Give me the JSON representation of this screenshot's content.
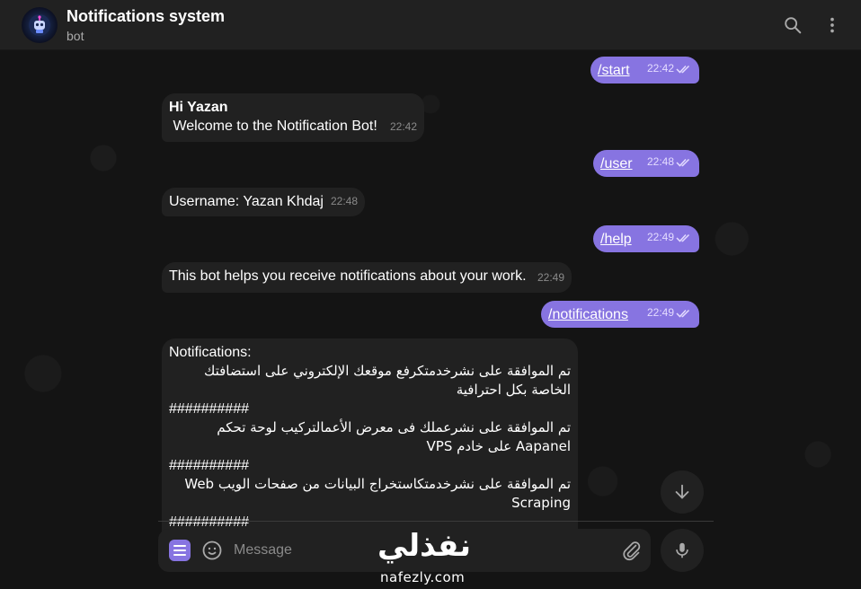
{
  "header": {
    "title": "Notifications system",
    "subtitle": "bot"
  },
  "messages": {
    "m1": {
      "text": "/start",
      "time": "22:42"
    },
    "m2": {
      "line1": "Hi Yazan",
      "line2": " Welcome to the Notification Bot!",
      "time": "22:42"
    },
    "m3": {
      "text": "/user",
      "time": "22:48"
    },
    "m4": {
      "text": "Username: Yazan Khdaj",
      "time": "22:48"
    },
    "m5": {
      "text": "/help",
      "time": "22:49"
    },
    "m6": {
      "text": "This bot helps you receive notifications about your work.",
      "time": "22:49"
    },
    "m7": {
      "text": "/notifications",
      "time": "22:49"
    },
    "m8": {
      "heading": "Notifications:",
      "item1": "تم الموافقة على نشرخدمتكرفع موقعك الإلكتروني على استضافتك الخاصة بكل احترافية",
      "sep1": "##########",
      "item2": "تم الموافقة على نشرعملك فى معرض الأعمالتركيب لوحة تحكم Aapanel على خادم VPS",
      "sep2": "##########",
      "item3": "تم الموافقة على نشرخدمتكاستخراج البيانات من صفحات الويب Web Scraping",
      "sep3": "##########"
    }
  },
  "composer": {
    "placeholder": "Message"
  },
  "watermark": {
    "arabic": "نفذلي",
    "latin": "nafezly.com"
  },
  "icons": {
    "search": "search-icon",
    "more": "more-vert-icon",
    "menu": "menu-icon",
    "emoji": "emoji-icon",
    "attach": "attach-icon",
    "mic": "mic-icon",
    "scroll": "arrow-down-icon",
    "read": "double-check-icon"
  },
  "colors": {
    "accent": "#8774e1",
    "bubble_in": "#212121",
    "header_bg": "#212121",
    "background": "#141414"
  }
}
